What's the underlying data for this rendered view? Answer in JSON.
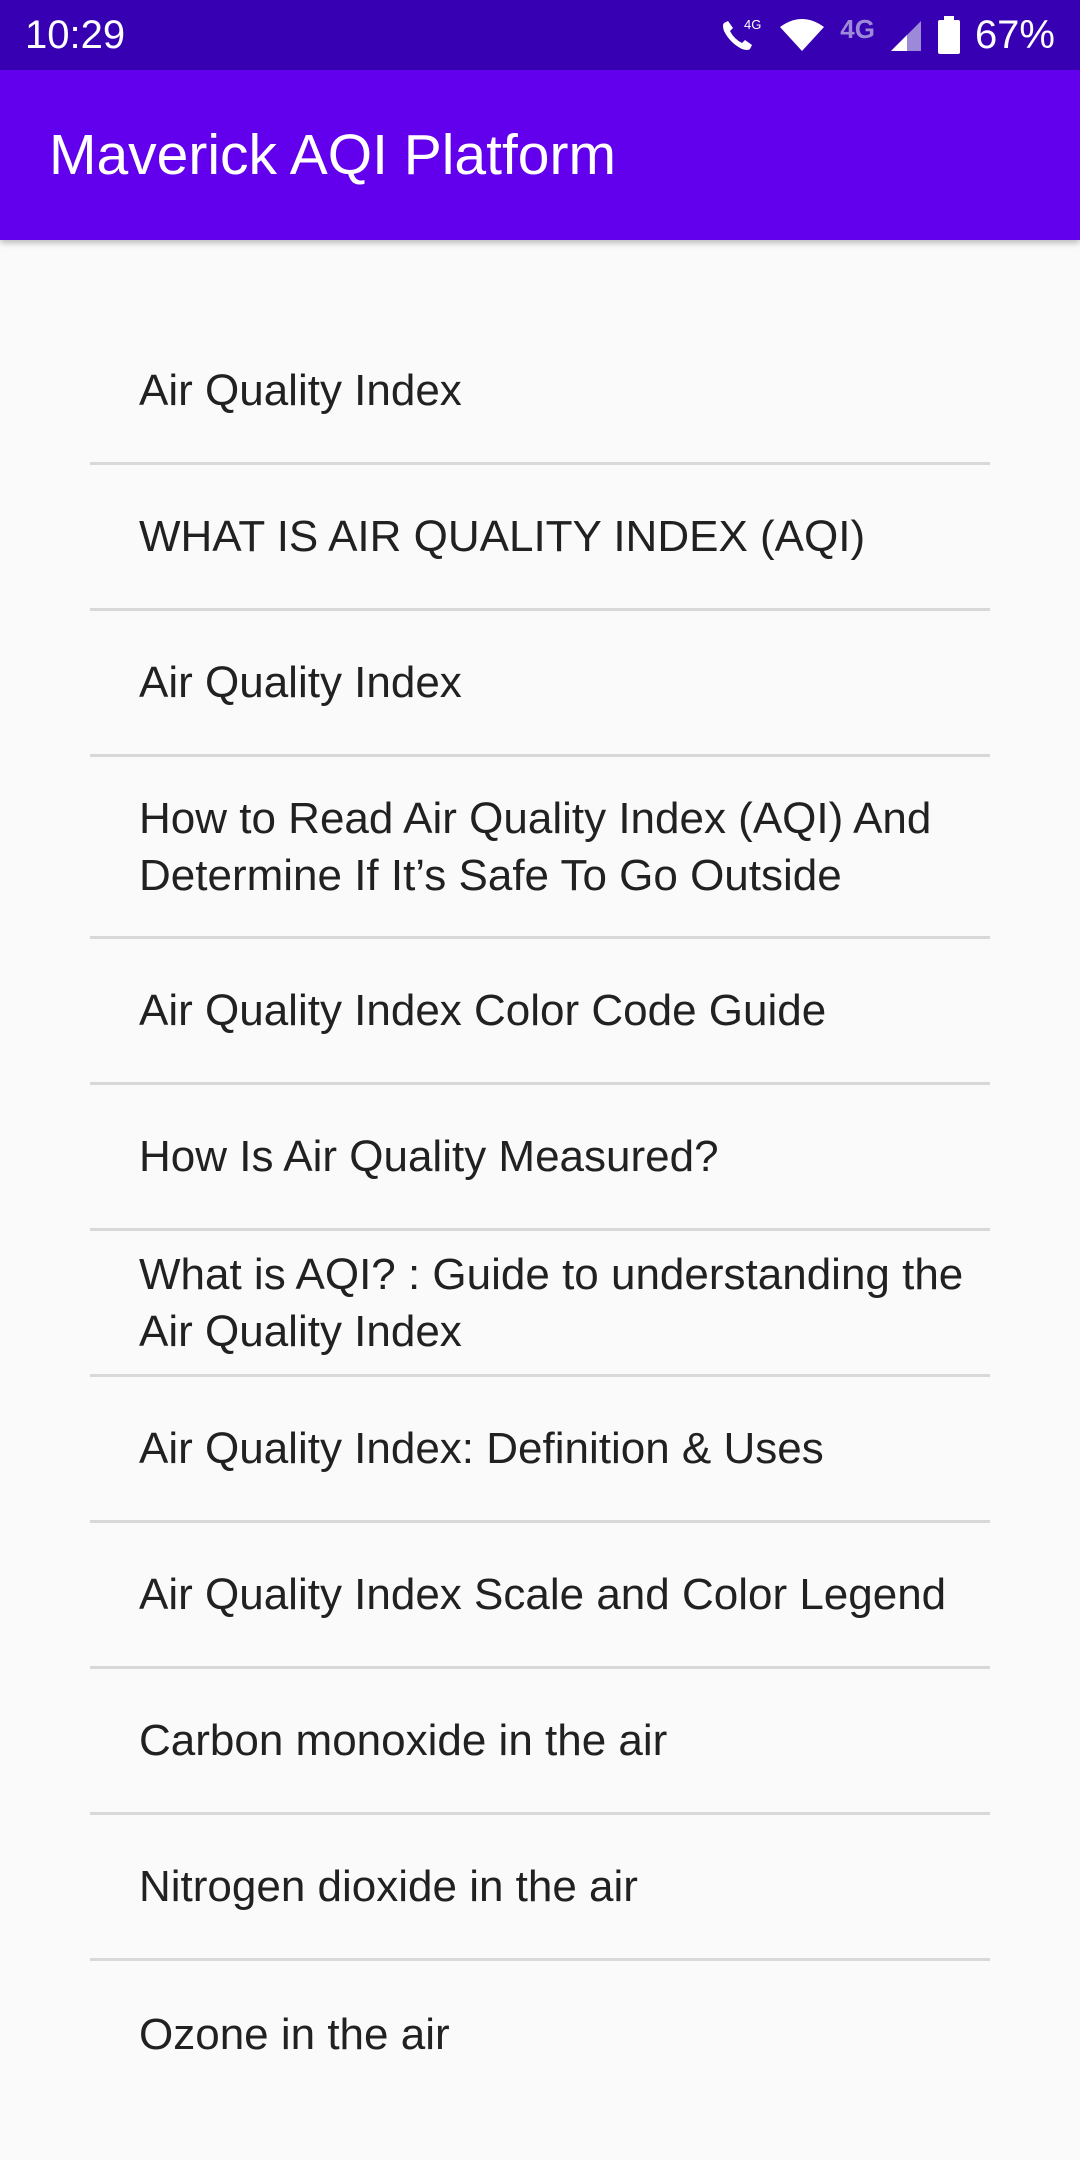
{
  "status_bar": {
    "time": "10:29",
    "network_label": "4G",
    "battery": "67%",
    "icons": [
      "wifi-call-icon",
      "wifi-icon",
      "signal-icon",
      "battery-icon"
    ],
    "color": "#3700b3"
  },
  "app_bar": {
    "title": "Maverick AQI Platform",
    "color": "#6200ee"
  },
  "list": {
    "items": [
      {
        "label": "Air Quality Index"
      },
      {
        "label": "WHAT IS AIR QUALITY INDEX (AQI)"
      },
      {
        "label": "Air Quality Index"
      },
      {
        "label": "How to Read Air Quality Index (AQI) And Determine If It’s Safe To Go Outside"
      },
      {
        "label": "Air Quality Index Color Code Guide"
      },
      {
        "label": "How Is Air Quality Measured?"
      },
      {
        "label": "What is AQI? : Guide to understanding the Air Quality Index"
      },
      {
        "label": "Air Quality Index: Definition & Uses"
      },
      {
        "label": "Air Quality Index Scale and Color Legend"
      },
      {
        "label": "Carbon monoxide in the air"
      },
      {
        "label": "Nitrogen dioxide in the air"
      },
      {
        "label": "Ozone in the air"
      }
    ]
  }
}
